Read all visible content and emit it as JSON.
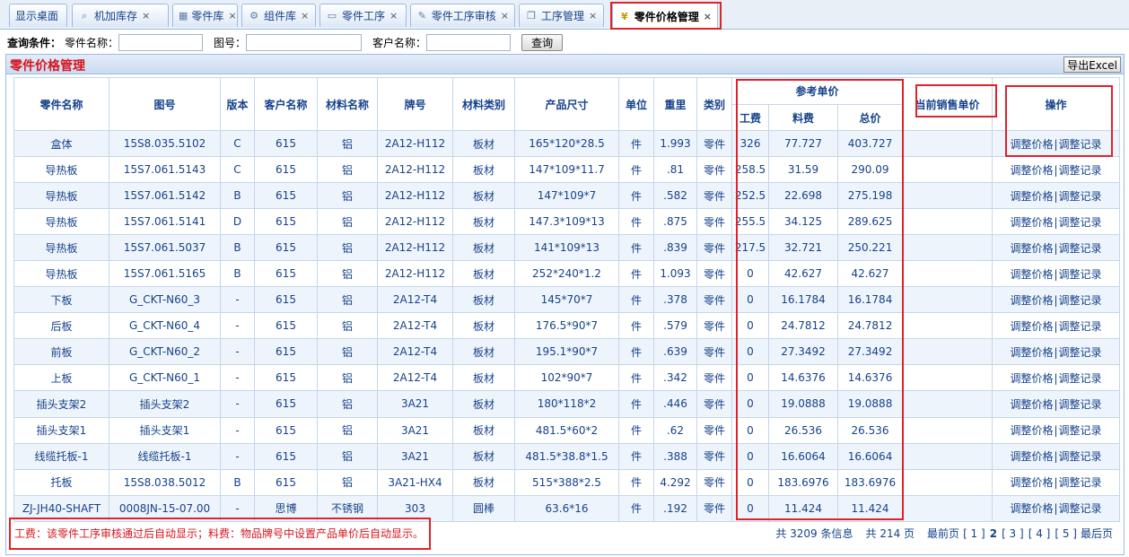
{
  "tabs": [
    {
      "label": "显示桌面",
      "icon": "",
      "closable": false
    },
    {
      "label": "机加库存",
      "icon": "search-icon",
      "closable": true
    },
    {
      "label": "零件库",
      "icon": "grid-icon",
      "closable": true
    },
    {
      "label": "组件库",
      "icon": "gear-icon",
      "closable": true
    },
    {
      "label": "零件工序",
      "icon": "window-icon",
      "closable": true
    },
    {
      "label": "零件工序审核",
      "icon": "edit-icon",
      "closable": true
    },
    {
      "label": "工序管理",
      "icon": "book-icon",
      "closable": true
    },
    {
      "label": "零件价格管理",
      "icon": "yen-icon",
      "closable": true,
      "active": true
    }
  ],
  "close_glyph": "×",
  "query": {
    "label": "查询条件：",
    "part_name_label": "零件名称：",
    "drawing_no_label": "图号：",
    "customer_label": "客户名称：",
    "search_button": "查询",
    "part_name_value": "",
    "drawing_no_value": "",
    "customer_value": ""
  },
  "panel": {
    "title": "零件价格管理",
    "export_button": "导出Excel"
  },
  "table": {
    "headers": {
      "part_name": "零件名称",
      "drawing_no": "图号",
      "version": "版本",
      "customer": "客户名称",
      "material_name": "材料名称",
      "grade": "牌号",
      "material_type": "材料类别",
      "size": "产品尺寸",
      "unit": "单位",
      "weight": "重里",
      "category": "类别",
      "ref_price": "参考单价",
      "labor": "工费",
      "material_cost": "料费",
      "total": "总价",
      "current_price": "当前销售单价",
      "action": "操作"
    },
    "action_adjust": "调整价格",
    "action_sep": "|",
    "action_log": "调整记录",
    "rows": [
      {
        "name": "盒体",
        "drawing": "15S8.035.5102",
        "ver": "C",
        "cust": "615",
        "mat": "铝",
        "grade": "2A12-H112",
        "mtype": "板材",
        "size": "165*120*28.5",
        "unit": "件",
        "weight": "1.993",
        "cat": "零件",
        "labor": "326",
        "mcost": "77.727",
        "total": "403.727",
        "cur": ""
      },
      {
        "name": "导热板",
        "drawing": "15S7.061.5143",
        "ver": "C",
        "cust": "615",
        "mat": "铝",
        "grade": "2A12-H112",
        "mtype": "板材",
        "size": "147*109*11.7",
        "unit": "件",
        "weight": ".81",
        "cat": "零件",
        "labor": "258.5",
        "mcost": "31.59",
        "total": "290.09",
        "cur": ""
      },
      {
        "name": "导热板",
        "drawing": "15S7.061.5142",
        "ver": "B",
        "cust": "615",
        "mat": "铝",
        "grade": "2A12-H112",
        "mtype": "板材",
        "size": "147*109*7",
        "unit": "件",
        "weight": ".582",
        "cat": "零件",
        "labor": "252.5",
        "mcost": "22.698",
        "total": "275.198",
        "cur": ""
      },
      {
        "name": "导热板",
        "drawing": "15S7.061.5141",
        "ver": "D",
        "cust": "615",
        "mat": "铝",
        "grade": "2A12-H112",
        "mtype": "板材",
        "size": "147.3*109*13",
        "unit": "件",
        "weight": ".875",
        "cat": "零件",
        "labor": "255.5",
        "mcost": "34.125",
        "total": "289.625",
        "cur": ""
      },
      {
        "name": "导热板",
        "drawing": "15S7.061.5037",
        "ver": "B",
        "cust": "615",
        "mat": "铝",
        "grade": "2A12-H112",
        "mtype": "板材",
        "size": "141*109*13",
        "unit": "件",
        "weight": ".839",
        "cat": "零件",
        "labor": "217.5",
        "mcost": "32.721",
        "total": "250.221",
        "cur": ""
      },
      {
        "name": "导热板",
        "drawing": "15S7.061.5165",
        "ver": "B",
        "cust": "615",
        "mat": "铝",
        "grade": "2A12-H112",
        "mtype": "板材",
        "size": "252*240*1.2",
        "unit": "件",
        "weight": "1.093",
        "cat": "零件",
        "labor": "0",
        "mcost": "42.627",
        "total": "42.627",
        "cur": ""
      },
      {
        "name": "下板",
        "drawing": "G_CKT-N60_3",
        "ver": "-",
        "cust": "615",
        "mat": "铝",
        "grade": "2A12-T4",
        "mtype": "板材",
        "size": "145*70*7",
        "unit": "件",
        "weight": ".378",
        "cat": "零件",
        "labor": "0",
        "mcost": "16.1784",
        "total": "16.1784",
        "cur": ""
      },
      {
        "name": "后板",
        "drawing": "G_CKT-N60_4",
        "ver": "-",
        "cust": "615",
        "mat": "铝",
        "grade": "2A12-T4",
        "mtype": "板材",
        "size": "176.5*90*7",
        "unit": "件",
        "weight": ".579",
        "cat": "零件",
        "labor": "0",
        "mcost": "24.7812",
        "total": "24.7812",
        "cur": ""
      },
      {
        "name": "前板",
        "drawing": "G_CKT-N60_2",
        "ver": "-",
        "cust": "615",
        "mat": "铝",
        "grade": "2A12-T4",
        "mtype": "板材",
        "size": "195.1*90*7",
        "unit": "件",
        "weight": ".639",
        "cat": "零件",
        "labor": "0",
        "mcost": "27.3492",
        "total": "27.3492",
        "cur": ""
      },
      {
        "name": "上板",
        "drawing": "G_CKT-N60_1",
        "ver": "-",
        "cust": "615",
        "mat": "铝",
        "grade": "2A12-T4",
        "mtype": "板材",
        "size": "102*90*7",
        "unit": "件",
        "weight": ".342",
        "cat": "零件",
        "labor": "0",
        "mcost": "14.6376",
        "total": "14.6376",
        "cur": ""
      },
      {
        "name": "插头支架2",
        "drawing": "插头支架2",
        "ver": "-",
        "cust": "615",
        "mat": "铝",
        "grade": "3A21",
        "mtype": "板材",
        "size": "180*118*2",
        "unit": "件",
        "weight": ".446",
        "cat": "零件",
        "labor": "0",
        "mcost": "19.0888",
        "total": "19.0888",
        "cur": ""
      },
      {
        "name": "插头支架1",
        "drawing": "插头支架1",
        "ver": "-",
        "cust": "615",
        "mat": "铝",
        "grade": "3A21",
        "mtype": "板材",
        "size": "481.5*60*2",
        "unit": "件",
        "weight": ".62",
        "cat": "零件",
        "labor": "0",
        "mcost": "26.536",
        "total": "26.536",
        "cur": ""
      },
      {
        "name": "线缆托板-1",
        "drawing": "线缆托板-1",
        "ver": "-",
        "cust": "615",
        "mat": "铝",
        "grade": "3A21",
        "mtype": "板材",
        "size": "481.5*38.8*1.5",
        "unit": "件",
        "weight": ".388",
        "cat": "零件",
        "labor": "0",
        "mcost": "16.6064",
        "total": "16.6064",
        "cur": ""
      },
      {
        "name": "托板",
        "drawing": "15S8.038.5012",
        "ver": "B",
        "cust": "615",
        "mat": "铝",
        "grade": "3A21-HX4",
        "mtype": "板材",
        "size": "515*388*2.5",
        "unit": "件",
        "weight": "4.292",
        "cat": "零件",
        "labor": "0",
        "mcost": "183.6976",
        "total": "183.6976",
        "cur": ""
      },
      {
        "name": "ZJ-JH40-SHAFT",
        "drawing": "0008JN-15-07.00",
        "ver": "-",
        "cust": "思博",
        "mat": "不锈钢",
        "grade": "303",
        "mtype": "圆棒",
        "size": "63.6*16",
        "unit": "件",
        "weight": ".192",
        "cat": "零件",
        "labor": "0",
        "mcost": "11.424",
        "total": "11.424",
        "cur": ""
      }
    ]
  },
  "footer": {
    "note": "工费：该零件工序审核通过后自动显示；料费：物品牌号中设置产品单价后自动显示。"
  },
  "pager": {
    "total_text": "共 3209 条信息",
    "pages_text": "共 214 页",
    "first": "最前页",
    "pages": [
      "[ 1 ]",
      "2",
      "[ 3 ]",
      "[ 4 ]",
      "[ 5 ]"
    ],
    "current_index": 1,
    "last": "最后页"
  },
  "colors": {
    "highlight_red": "#e0222a",
    "title_red": "#d6141d",
    "link_blue": "#15428b",
    "row_alt": "#eef4fb"
  }
}
